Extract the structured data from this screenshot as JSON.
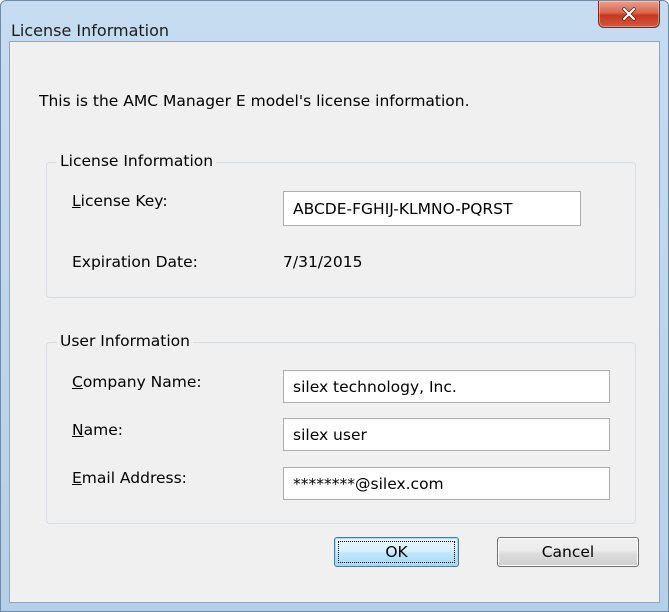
{
  "window": {
    "title": "License Information",
    "close_label": "X"
  },
  "description": "This is the AMC Manager E model's license information.",
  "license_group": {
    "legend": "License Information",
    "license_key": {
      "mnemonic": "L",
      "label_rest": "icense Key:",
      "value": "ABCDE-FGHIJ-KLMNO-PQRST"
    },
    "expiration": {
      "label": "Expiration Date:",
      "value": "7/31/2015"
    }
  },
  "user_group": {
    "legend": "User Information",
    "company": {
      "mnemonic": "C",
      "label_rest": "ompany Name:",
      "value": "silex technology, Inc."
    },
    "name": {
      "mnemonic": "N",
      "label_rest": "ame:",
      "value": "silex user"
    },
    "email": {
      "mnemonic": "E",
      "label_rest": "mail Address:",
      "value": "********@silex.com"
    }
  },
  "buttons": {
    "ok": "OK",
    "cancel": "Cancel"
  },
  "colors": {
    "close_button": "#c4391f",
    "ok_button_border": "#3c7fb1",
    "dialog_background": "#f0f0f0",
    "title_bar": "#c6dcf1"
  }
}
